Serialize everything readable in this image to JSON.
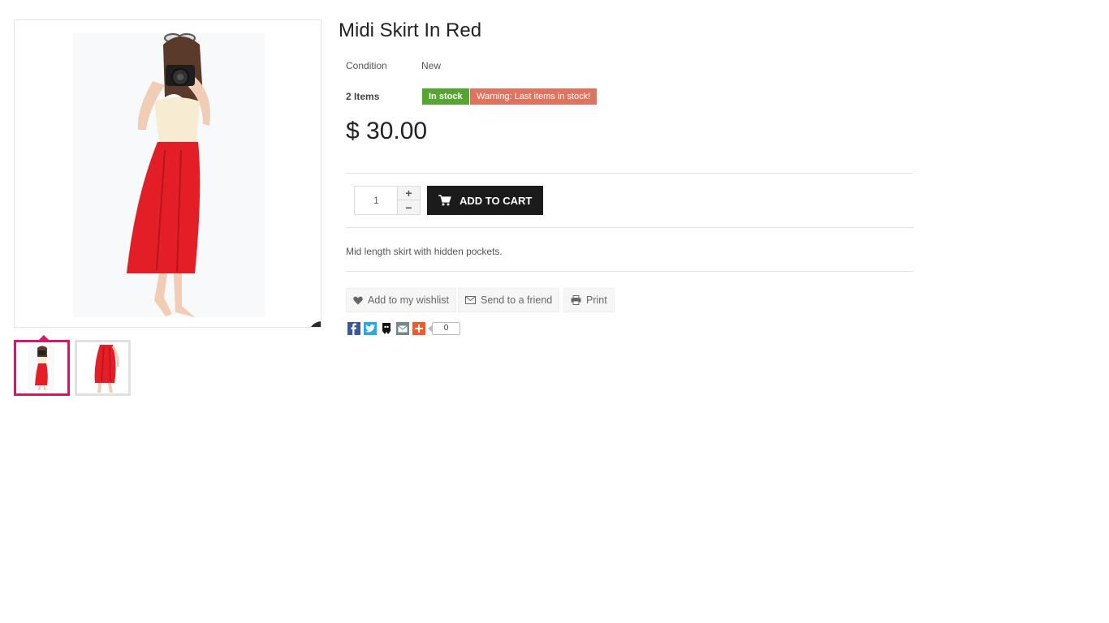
{
  "product": {
    "title": "Midi Skirt In Red",
    "condition_label": "Condition",
    "condition_value": "New",
    "quantity_number": "2",
    "quantity_unit": "Items",
    "stock_badge": "In stock",
    "warning_badge": "Warning: Last items in stock!",
    "price": "$ 30.00",
    "description": "Mid length skirt with hidden pockets."
  },
  "cart": {
    "quantity_value": "1",
    "add_to_cart_label": "ADD TO CART"
  },
  "actions": {
    "wishlist_label": "Add to my wishlist",
    "send_label": "Send to a friend",
    "print_label": "Print"
  },
  "share": {
    "count": "0",
    "icons": [
      "facebook-icon",
      "twitter-icon",
      "pinterest-icon",
      "email-icon",
      "addthis-plus-icon"
    ]
  },
  "colors": {
    "accent": "#d5166a",
    "in_stock": "#55a630",
    "warning": "#e0735e",
    "cart_button": "#1b1b1b"
  }
}
